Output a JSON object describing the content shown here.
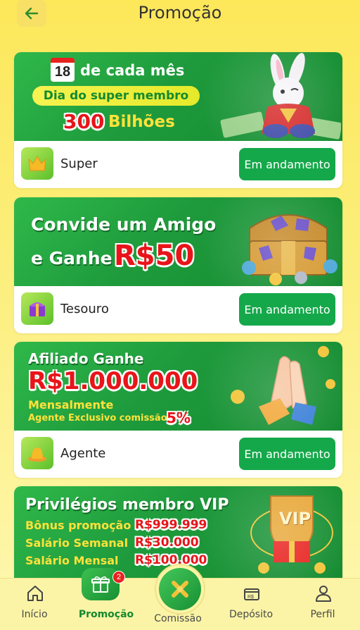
{
  "header": {
    "title": "Promoção"
  },
  "colors": {
    "primary_green": "#15a84a",
    "background_yellow": "#fde85a",
    "badge_red": "#e8231f"
  },
  "cards": [
    {
      "banner": {
        "date_number": "18",
        "line1": "de cada mês",
        "pill": "Dia do super membro",
        "highlight": "300",
        "highlight_suffix": "Bilhões"
      },
      "label": "Super",
      "status": "Em andamento",
      "icon": "crown-icon"
    },
    {
      "banner": {
        "line1": "Convide um Amigo",
        "line2_prefix": "e Ganhe",
        "line2_highlight": "R$50"
      },
      "label": "Tesouro",
      "status": "Em andamento",
      "icon": "treasure-chest-icon"
    },
    {
      "banner": {
        "line1": "Afiliado Ganhe",
        "highlight": "R$1.000.000",
        "line3": "Mensalmente",
        "line4": "Agente Exclusivo comissão",
        "line4_highlight": "5%"
      },
      "label": "Agente",
      "status": "Em andamento",
      "icon": "agent-hat-icon"
    },
    {
      "banner": {
        "title": "Privilégios membro VIP",
        "rows": [
          {
            "label": "Bônus promoção",
            "value": "R$999.999"
          },
          {
            "label": "Salário Semanal",
            "value": "R$30.000"
          },
          {
            "label": "Salário Mensal",
            "value": "R$100.000"
          }
        ],
        "vip_text": "VIP"
      }
    }
  ],
  "nav": {
    "items": [
      {
        "label": "Início",
        "icon": "home-icon"
      },
      {
        "label": "Promoção",
        "icon": "gift-icon",
        "badge": "2"
      },
      {
        "label": "Comissão",
        "icon": "commission-icon"
      },
      {
        "label": "Depósito",
        "icon": "deposit-icon"
      },
      {
        "label": "Perfil",
        "icon": "user-icon"
      }
    ]
  }
}
